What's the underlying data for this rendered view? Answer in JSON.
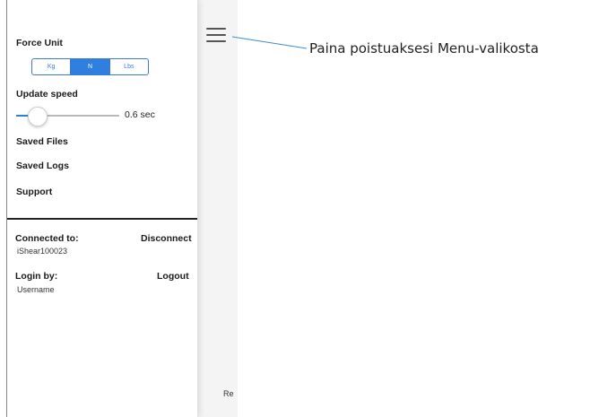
{
  "drawer": {
    "force_unit": {
      "label": "Force Unit",
      "options": [
        "Kg",
        "N",
        "Lbs"
      ],
      "selected": "N"
    },
    "update_speed": {
      "label": "Update speed",
      "value_text": "0.6 sec",
      "slider_fraction": 0.2
    },
    "menu": {
      "saved_files": "Saved Files",
      "saved_logs": "Saved Logs",
      "support": "Support"
    },
    "connection": {
      "label": "Connected to:",
      "device": "iShear100023",
      "action": "Disconnect"
    },
    "login": {
      "label": "Login by:",
      "user": "Username",
      "action": "Logout"
    }
  },
  "background": {
    "partial_text": "Re"
  },
  "annotation": {
    "text": "Paina poistuaksesi Menu-valikosta"
  },
  "colors": {
    "accent": "#2f7fe0",
    "divider": "#222222"
  },
  "icons": {
    "menu": "hamburger-icon"
  }
}
